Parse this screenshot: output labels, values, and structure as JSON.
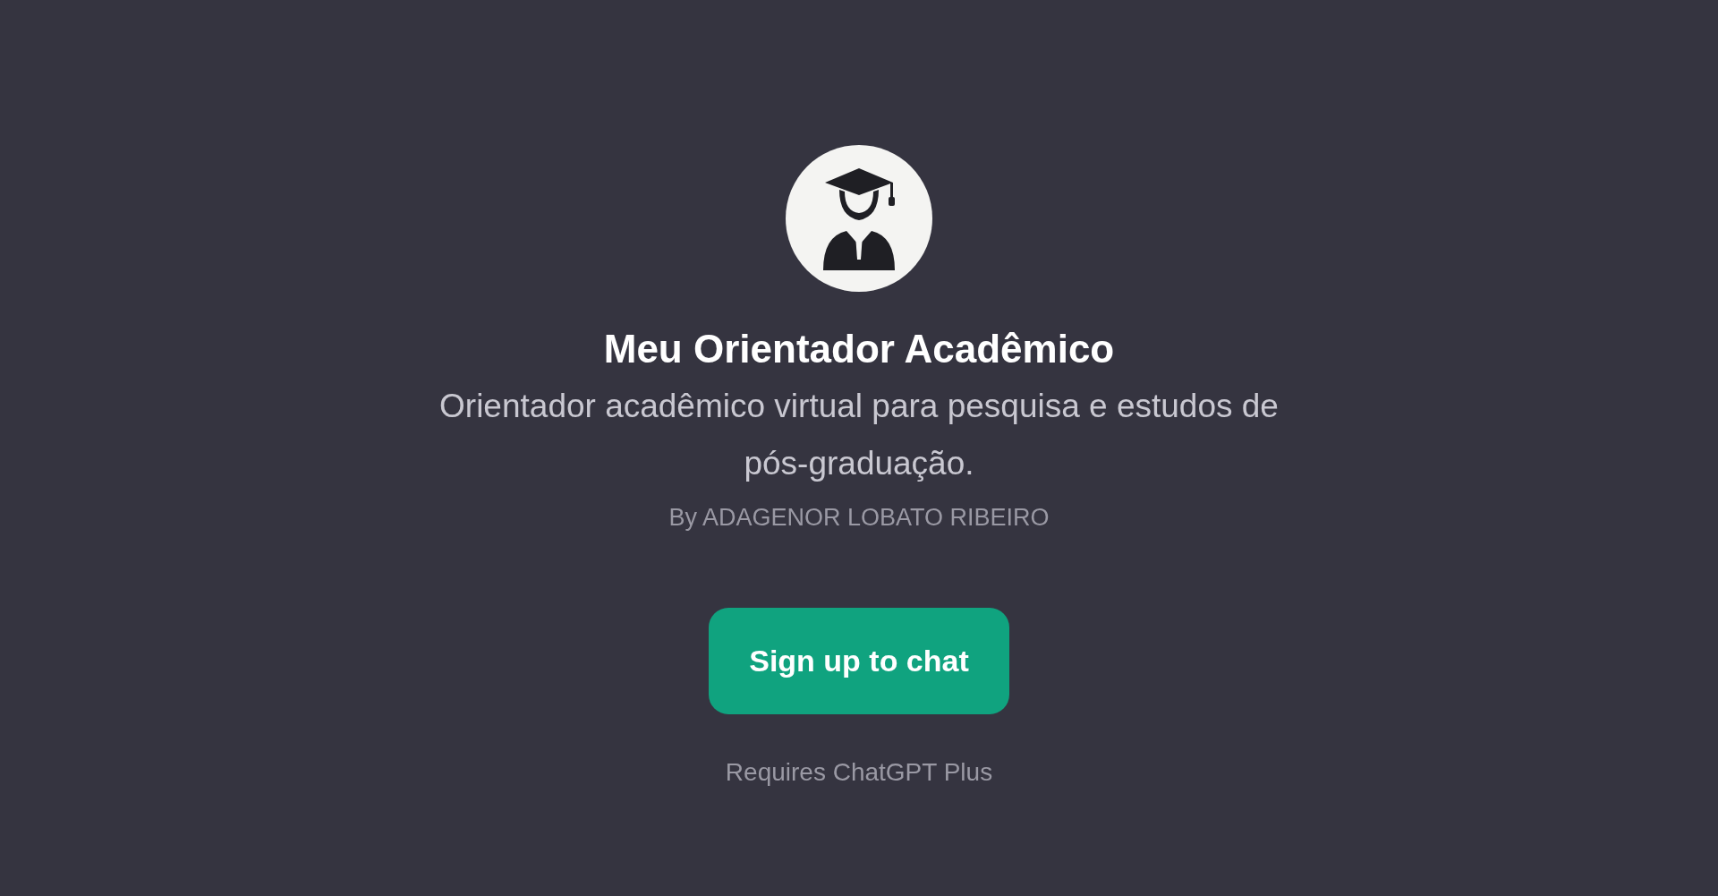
{
  "title": "Meu Orientador Acadêmico",
  "description": "Orientador acadêmico virtual para pesquisa e estudos de pós-graduação.",
  "author": "By ADAGENOR LOBATO RIBEIRO",
  "signup_button": "Sign up to chat",
  "requirement": "Requires ChatGPT Plus"
}
